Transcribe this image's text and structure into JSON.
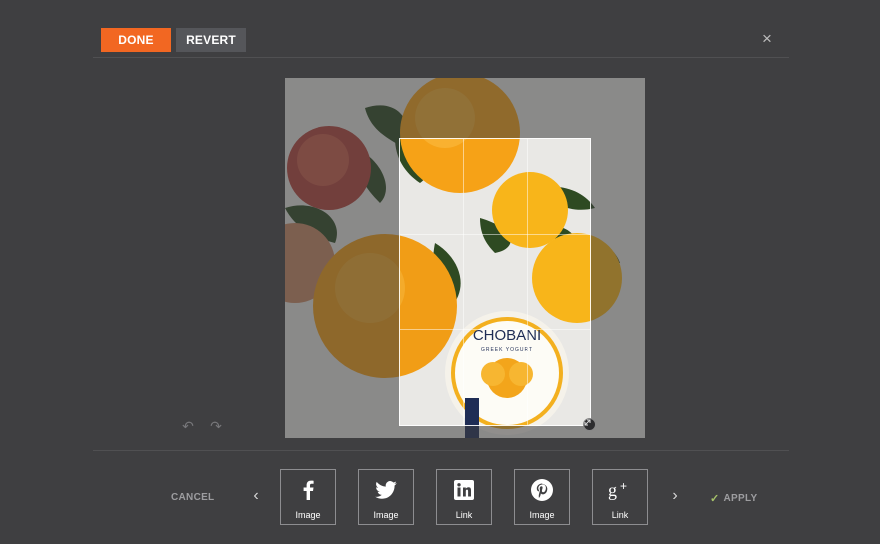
{
  "toolbar": {
    "done_label": "DONE",
    "revert_label": "REVERT",
    "close_glyph": "×"
  },
  "editor": {
    "image_brand_text": "CHOBANI",
    "image_sub_text": "GREEK YOGURT",
    "undo_glyph": "↶",
    "redo_glyph": "↷"
  },
  "footer": {
    "cancel_label": "CANCEL",
    "apply_label": "APPLY",
    "apply_icon": "✓",
    "prev_glyph": "‹",
    "next_glyph": "›",
    "share": [
      {
        "network": "facebook",
        "icon": "facebook-icon",
        "label": "Image"
      },
      {
        "network": "twitter",
        "icon": "twitter-icon",
        "label": "Image"
      },
      {
        "network": "linkedin",
        "icon": "linkedin-icon",
        "label": "Link"
      },
      {
        "network": "pinterest",
        "icon": "pinterest-icon",
        "label": "Image"
      },
      {
        "network": "google-plus",
        "icon": "google-plus-icon",
        "label": "Link"
      }
    ]
  },
  "colors": {
    "background": "#3f3f41",
    "accent": "#f26722",
    "secondary_button": "#55565a",
    "apply_check": "#a6c26a"
  }
}
